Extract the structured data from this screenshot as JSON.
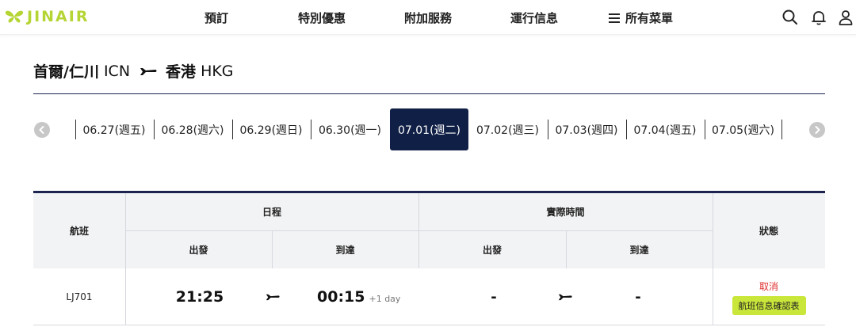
{
  "header": {
    "logo_text": "JINAIR",
    "nav": [
      "預訂",
      "特別優惠",
      "附加服務",
      "運行信息"
    ],
    "menu_label": "所有菜單",
    "icons": [
      "search-icon",
      "bell-icon",
      "user-icon"
    ],
    "brand_color": "#b5d534"
  },
  "route": {
    "from_city": "首爾/仁川",
    "from_code": "ICN",
    "to_city": "香港",
    "to_code": "HKG"
  },
  "dates": [
    "06.27(週五)",
    "06.28(週六)",
    "06.29(週日)",
    "06.30(週一)",
    "07.01(週二)",
    "07.02(週三)",
    "07.03(週四)",
    "07.04(週五)",
    "07.05(週六)"
  ],
  "selected_date": "07.01(週二)",
  "table": {
    "headers": {
      "flight": "航班",
      "schedule": "日程",
      "actual": "實際時間",
      "status": "狀態",
      "depart": "出發",
      "arrive": "到達"
    },
    "rows": [
      {
        "flight": "LJ701",
        "sched_depart": "21:25",
        "sched_arrive": "00:15",
        "day_offset": "+1 day",
        "actual_depart": "-",
        "actual_arrive": "-",
        "status": "取消",
        "status_button": "航班信息確認表"
      }
    ]
  },
  "colors": {
    "navy": "#101f45",
    "cancel_red": "#e03030",
    "lime": "#c9e63a"
  }
}
